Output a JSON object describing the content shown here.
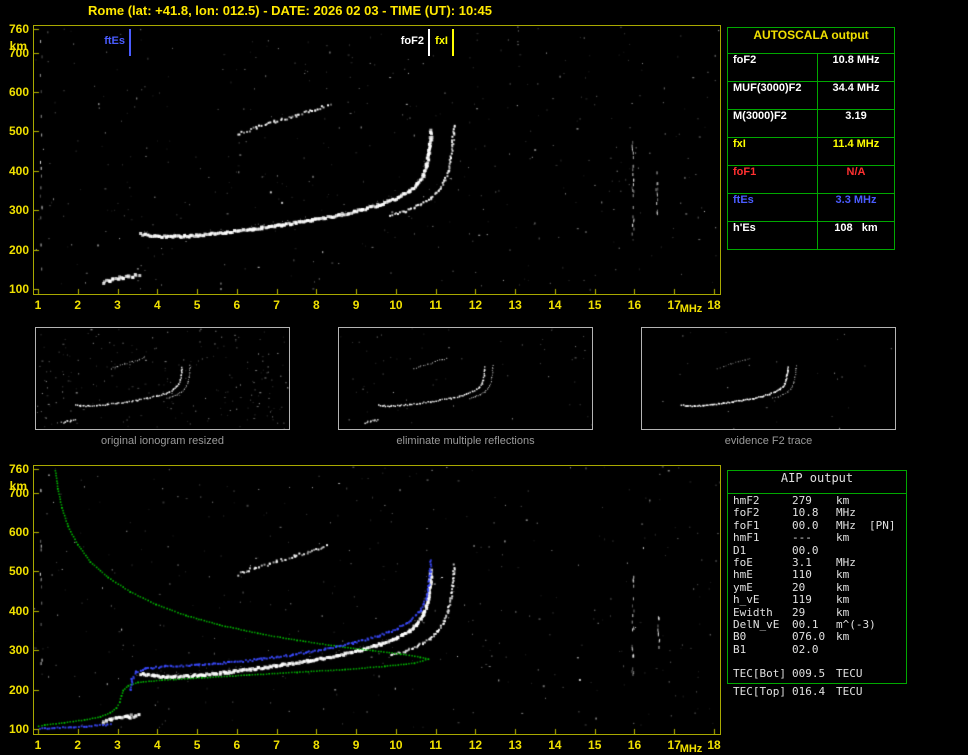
{
  "header": {
    "title": "Rome (lat: +41.8, lon: 012.5) - DATE: 2026 02 03 - TIME (UT): 10:45"
  },
  "autoscala": {
    "title": "AUTOSCALA output",
    "rows": [
      {
        "param": "foF2",
        "value": "10.8 MHz",
        "color": "#ffffff"
      },
      {
        "param": "MUF(3000)F2",
        "value": "34.4 MHz",
        "color": "#ffffff"
      },
      {
        "param": "M(3000)F2",
        "value": "3.19",
        "color": "#ffffff"
      },
      {
        "param": "fxI",
        "value": "11.4 MHz",
        "color": "#ffff00"
      },
      {
        "param": "foF1",
        "value": "N/A",
        "color": "#ff3030"
      },
      {
        "param": "ftEs",
        "value": "3.3 MHz",
        "color": "#4a5cff"
      },
      {
        "param": "h'Es",
        "value": "108   km",
        "color": "#ffffff"
      }
    ]
  },
  "aip": {
    "title": "AIP output",
    "rows": [
      {
        "param": "hmF2",
        "value": "279",
        "unit": "km",
        "extra": ""
      },
      {
        "param": "foF2",
        "value": "10.8",
        "unit": "MHz",
        "extra": ""
      },
      {
        "param": "foF1",
        "value": "00.0",
        "unit": "MHz",
        "extra": "[PN]"
      },
      {
        "param": "hmF1",
        "value": "---",
        "unit": "km",
        "extra": ""
      },
      {
        "param": "D1",
        "value": "00.0",
        "unit": "",
        "extra": ""
      },
      {
        "param": "foE",
        "value": "3.1",
        "unit": "MHz",
        "extra": ""
      },
      {
        "param": "hmE",
        "value": "110",
        "unit": "km",
        "extra": ""
      },
      {
        "param": "ymE",
        "value": "20",
        "unit": "km",
        "extra": ""
      },
      {
        "param": "h_vE",
        "value": "119",
        "unit": "km",
        "extra": ""
      },
      {
        "param": "Ewidth",
        "value": "29",
        "unit": "km",
        "extra": ""
      },
      {
        "param": "DelN_vE",
        "value": "00.1",
        "unit": "m^(-3)",
        "extra": ""
      },
      {
        "param": "B0",
        "value": "076.0",
        "unit": "km",
        "extra": ""
      },
      {
        "param": "B1",
        "value": "02.0",
        "unit": "",
        "extra": ""
      }
    ],
    "tec_rows": [
      {
        "param": "TEC[Bot]",
        "value": "009.5",
        "unit": "TECU"
      },
      {
        "param": "TEC[Top]",
        "value": "016.4",
        "unit": "TECU"
      }
    ]
  },
  "thumbnails": [
    {
      "caption": "original ionogram resized"
    },
    {
      "caption": "eliminate multiple reflections"
    },
    {
      "caption": "evidence F2 trace"
    }
  ],
  "chart_data": {
    "type": "scatter",
    "description": "Ionogram: virtual height (km) vs sounding frequency (MHz), two panels",
    "x_unit": "MHz",
    "y_unit": "km",
    "xlim": [
      1,
      18
    ],
    "ylim": [
      100,
      760
    ],
    "x_ticks": [
      1,
      2,
      3,
      4,
      5,
      6,
      7,
      8,
      9,
      10,
      11,
      12,
      13,
      14,
      15,
      16,
      17,
      18
    ],
    "y_ticks": [
      760,
      700,
      600,
      500,
      400,
      300,
      200,
      100
    ],
    "trace_color": "#ffffff",
    "profile_color": "#00c400",
    "restored_color": "#3a4aff",
    "markers": [
      {
        "label": "ftEs",
        "freq": 3.3,
        "color": "#4a5cff"
      },
      {
        "label": "foF2",
        "freq": 10.8,
        "color": "#ffffff"
      },
      {
        "label": "fxI",
        "freq": 11.4,
        "color": "#ffff00"
      }
    ],
    "traces": {
      "f2_ordinary": [
        [
          3.55,
          243
        ],
        [
          3.9,
          238
        ],
        [
          4.4,
          236
        ],
        [
          5.0,
          240
        ],
        [
          5.7,
          247
        ],
        [
          6.4,
          256
        ],
        [
          7.1,
          266
        ],
        [
          7.8,
          277
        ],
        [
          8.5,
          290
        ],
        [
          9.1,
          304
        ],
        [
          9.6,
          319
        ],
        [
          10.0,
          335
        ],
        [
          10.3,
          352
        ],
        [
          10.5,
          370
        ],
        [
          10.65,
          392
        ],
        [
          10.74,
          418
        ],
        [
          10.8,
          450
        ],
        [
          10.84,
          482
        ],
        [
          10.86,
          505
        ]
      ],
      "f2_extraordinary": [
        [
          9.85,
          288
        ],
        [
          10.2,
          299
        ],
        [
          10.55,
          314
        ],
        [
          10.85,
          332
        ],
        [
          11.05,
          352
        ],
        [
          11.2,
          376
        ],
        [
          11.3,
          404
        ],
        [
          11.36,
          436
        ],
        [
          11.4,
          468
        ],
        [
          11.43,
          498
        ],
        [
          11.44,
          518
        ]
      ],
      "multiple_reflection": [
        [
          6.0,
          495
        ],
        [
          6.45,
          511
        ],
        [
          6.95,
          527
        ],
        [
          7.45,
          542
        ],
        [
          7.95,
          557
        ],
        [
          8.25,
          567
        ]
      ],
      "sporadic_e": [
        [
          2.6,
          120
        ],
        [
          2.8,
          126
        ],
        [
          3.0,
          131
        ],
        [
          3.25,
          135
        ],
        [
          3.5,
          138
        ]
      ],
      "restored_trace_blue": [
        [
          3.3,
          200
        ],
        [
          3.34,
          228
        ],
        [
          3.45,
          246
        ],
        [
          3.7,
          256
        ],
        [
          4.2,
          261
        ],
        [
          5.0,
          265
        ],
        [
          5.8,
          271
        ],
        [
          6.6,
          280
        ],
        [
          7.4,
          291
        ],
        [
          8.2,
          305
        ],
        [
          8.9,
          320
        ],
        [
          9.5,
          337
        ],
        [
          10.0,
          356
        ],
        [
          10.35,
          378
        ],
        [
          10.6,
          404
        ],
        [
          10.73,
          432
        ],
        [
          10.8,
          465
        ],
        [
          10.84,
          500
        ],
        [
          10.86,
          530
        ]
      ],
      "es_blue": [
        [
          1.02,
          104
        ],
        [
          1.4,
          105
        ],
        [
          1.8,
          107
        ],
        [
          2.2,
          109
        ],
        [
          2.6,
          112
        ],
        [
          2.8,
          114
        ]
      ],
      "electron_density_profile_green": {
        "topside": [
          [
            1.42,
            758
          ],
          [
            1.48,
            712
          ],
          [
            1.58,
            664
          ],
          [
            1.74,
            616
          ],
          [
            1.98,
            570
          ],
          [
            2.3,
            526
          ],
          [
            2.75,
            486
          ],
          [
            3.3,
            450
          ],
          [
            3.95,
            418
          ],
          [
            4.7,
            390
          ],
          [
            5.55,
            366
          ],
          [
            6.5,
            345
          ],
          [
            7.5,
            327
          ],
          [
            8.5,
            312
          ],
          [
            9.4,
            301
          ],
          [
            10.1,
            292
          ],
          [
            10.6,
            284
          ],
          [
            10.8,
            279
          ]
        ],
        "bottomside": [
          [
            10.8,
            279
          ],
          [
            10.45,
            269
          ],
          [
            9.7,
            261
          ],
          [
            8.7,
            253
          ],
          [
            7.5,
            246
          ],
          [
            6.3,
            239
          ],
          [
            5.1,
            232
          ],
          [
            4.1,
            226
          ],
          [
            3.5,
            220
          ],
          [
            3.25,
            212
          ],
          [
            3.12,
            200
          ],
          [
            3.08,
            186
          ],
          [
            3.04,
            170
          ],
          [
            2.95,
            155
          ],
          [
            2.8,
            143
          ],
          [
            2.55,
            133
          ],
          [
            2.15,
            125
          ],
          [
            1.65,
            118
          ],
          [
            1.15,
            112
          ],
          [
            1.0,
            109
          ]
        ]
      }
    },
    "noise_columns": [
      {
        "plot": "top",
        "f": 15.95,
        "h_from": 235,
        "h_to": 480,
        "n": 26
      },
      {
        "plot": "top",
        "f": 16.55,
        "h_from": 290,
        "h_to": 400,
        "n": 12
      },
      {
        "plot": "top",
        "f": 1.07,
        "h_from": 105,
        "h_to": 745,
        "n": 16
      },
      {
        "plot": "bottom",
        "f": 15.95,
        "h_from": 240,
        "h_to": 490,
        "n": 24
      },
      {
        "plot": "bottom",
        "f": 16.6,
        "h_from": 300,
        "h_to": 390,
        "n": 10
      },
      {
        "plot": "bottom",
        "f": 1.07,
        "h_from": 120,
        "h_to": 745,
        "n": 14
      }
    ]
  }
}
